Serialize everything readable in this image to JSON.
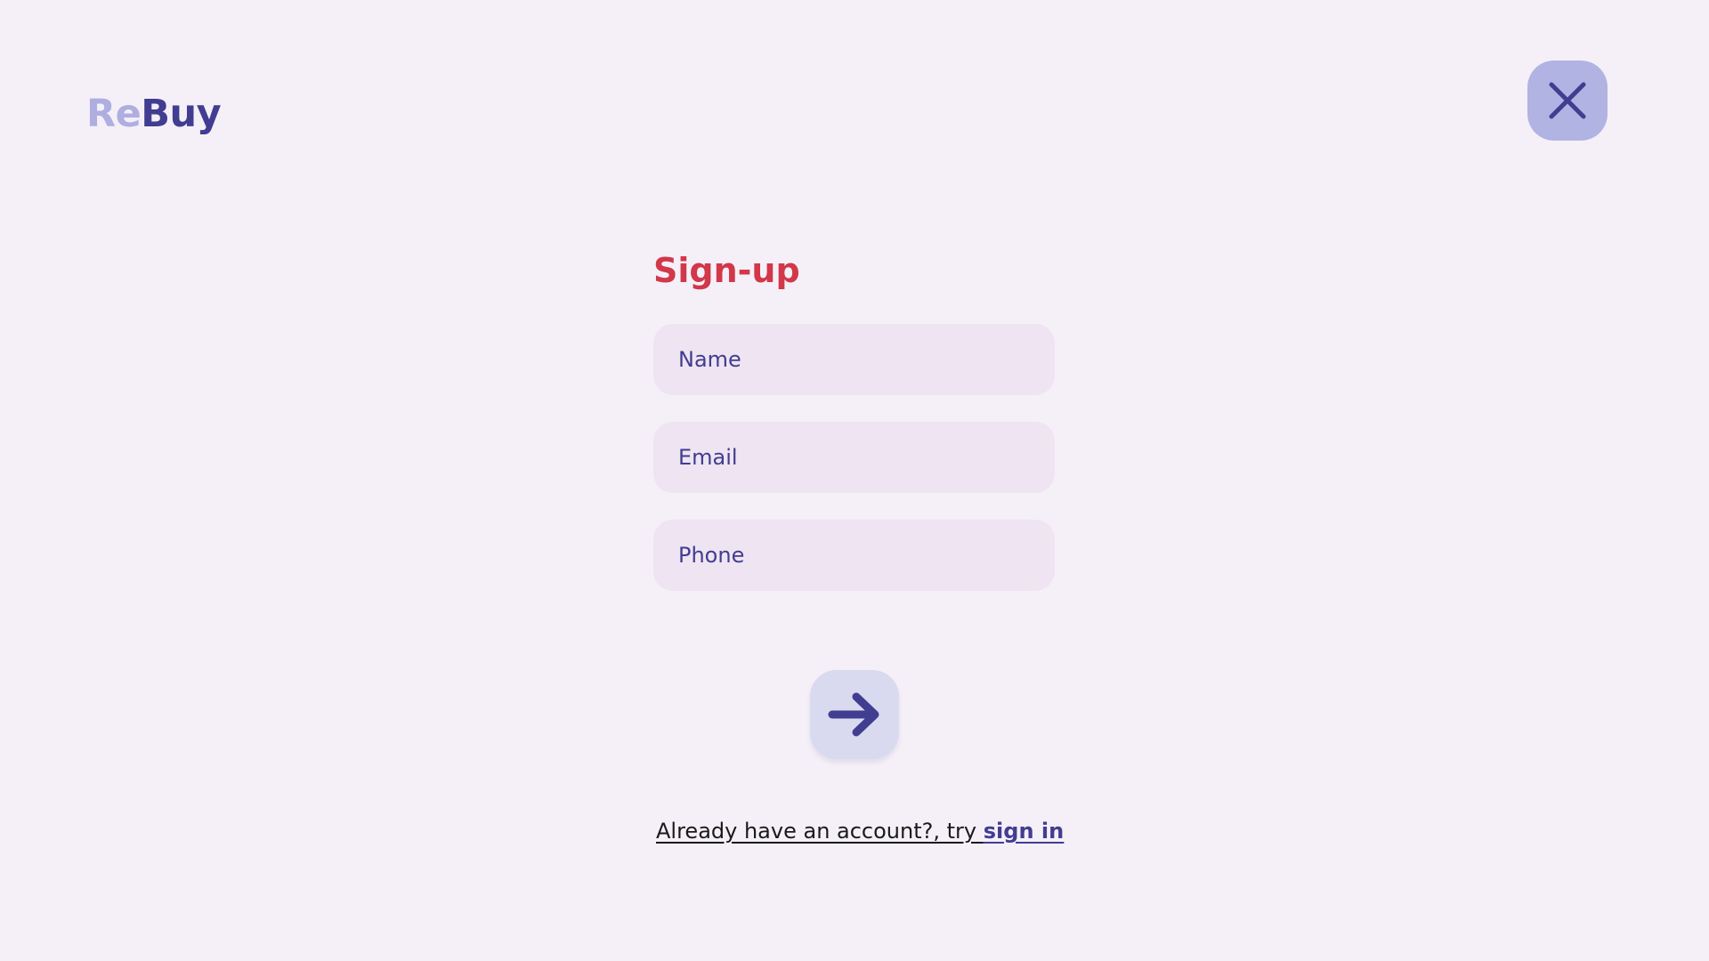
{
  "brand": {
    "logo_part1": "Re",
    "logo_part2": "Buy",
    "color_light": "#AFAEE0",
    "color_dark": "#413D91"
  },
  "header": {
    "close_icon": "close-icon"
  },
  "form": {
    "title": "Sign-up",
    "fields": [
      {
        "label": "Name"
      },
      {
        "label": "Email"
      },
      {
        "label": "Phone"
      }
    ],
    "submit_icon": "arrow-right-icon"
  },
  "footer": {
    "prompt_text": "Already have an account?, try ",
    "link_text": "sign in"
  },
  "colors": {
    "background": "#F5F0F8",
    "title": "#D2374A",
    "field_background": "#EFE4F1",
    "accent": "#413D91",
    "close_button": "#B1B3E2",
    "submit_button": "#D9D9F0"
  }
}
